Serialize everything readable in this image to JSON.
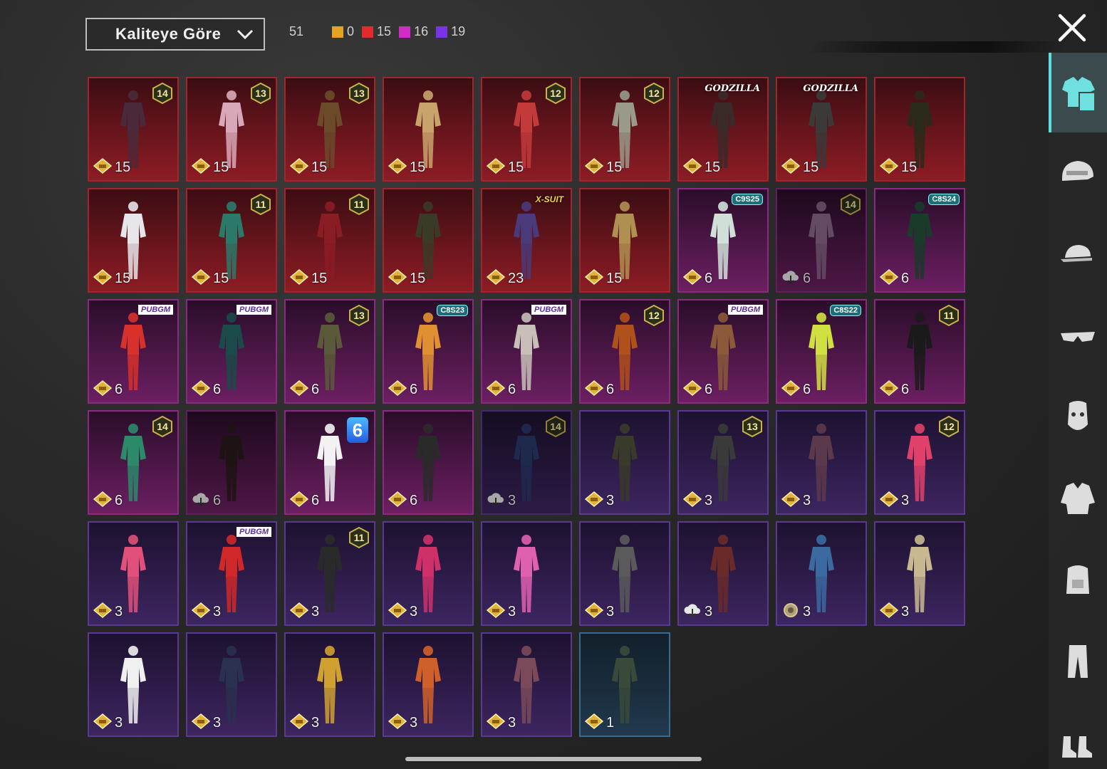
{
  "header": {
    "sort_label": "Kaliteye Göre",
    "total": "51",
    "quality_counts": [
      {
        "color": "#e3a323",
        "count": "0"
      },
      {
        "color": "#e02c2c",
        "count": "15"
      },
      {
        "color": "#d12cc6",
        "count": "16"
      },
      {
        "color": "#7a34e8",
        "count": "19"
      }
    ]
  },
  "items": [
    {
      "tier": "red",
      "badge": "14",
      "count": "15",
      "outfit": "#4a2a3a"
    },
    {
      "tier": "red",
      "badge": "13",
      "count": "15",
      "outfit": "#d9a8b8"
    },
    {
      "tier": "red",
      "badge": "13",
      "count": "15",
      "outfit": "#6b4a2a"
    },
    {
      "tier": "red",
      "badge": "",
      "count": "15",
      "outfit": "#c9a46a"
    },
    {
      "tier": "red",
      "badge": "12",
      "count": "15",
      "outfit": "#c23a3a"
    },
    {
      "tier": "red",
      "badge": "12",
      "count": "15",
      "outfit": "#9a9a8a"
    },
    {
      "tier": "red",
      "label": "GODZILLA",
      "count": "15",
      "outfit": "#3a2a28"
    },
    {
      "tier": "red",
      "label": "GODZILLA",
      "count": "15",
      "outfit": "#3a3a38"
    },
    {
      "tier": "red",
      "badge": "",
      "count": "15",
      "outfit": "#2a2a1a"
    },
    {
      "tier": "red",
      "badge": "",
      "count": "15",
      "outfit": "#e6e6ea"
    },
    {
      "tier": "red",
      "badge": "11",
      "count": "15",
      "outfit": "#2a7a6a"
    },
    {
      "tier": "red",
      "badge": "11",
      "count": "15",
      "outfit": "#8a1c24"
    },
    {
      "tier": "red",
      "badge": "",
      "count": "15",
      "outfit": "#3a3a28"
    },
    {
      "tier": "red",
      "label": "X-SUIT",
      "count": "23",
      "outfit": "#4a3a7a"
    },
    {
      "tier": "red",
      "badge": "",
      "count": "15",
      "outfit": "#b09050"
    },
    {
      "tier": "purple",
      "label": "C9S25",
      "count": "6",
      "outfit": "#d0e0d8"
    },
    {
      "tier": "purple",
      "badge": "14",
      "count": "6",
      "outfit": "#8a6a8a",
      "dim": true,
      "cloud": true
    },
    {
      "tier": "purple",
      "label": "C8S24",
      "count": "6",
      "outfit": "#1a3a2a"
    },
    {
      "tier": "purple",
      "label": "PUBGM",
      "count": "6",
      "outfit": "#d8302a"
    },
    {
      "tier": "purple",
      "label": "PUBGM",
      "count": "6",
      "outfit": "#1a4a4a"
    },
    {
      "tier": "purple",
      "badge": "13",
      "count": "6",
      "outfit": "#5a5a3a"
    },
    {
      "tier": "purple",
      "label": "C8S23",
      "count": "6",
      "outfit": "#e09030"
    },
    {
      "tier": "purple",
      "label": "PUBGM",
      "count": "6",
      "outfit": "#c8c0b8"
    },
    {
      "tier": "purple",
      "badge": "12",
      "count": "6",
      "outfit": "#b0501a"
    },
    {
      "tier": "purple",
      "label": "PUBGM",
      "count": "6",
      "outfit": "#8a5a3a"
    },
    {
      "tier": "purple",
      "label": "C8S22",
      "count": "6",
      "outfit": "#d0e040"
    },
    {
      "tier": "purple",
      "badge": "11",
      "count": "6",
      "outfit": "#1a1a1a"
    },
    {
      "tier": "purple",
      "badge": "14",
      "count": "6",
      "outfit": "#2a8a6a"
    },
    {
      "tier": "purple",
      "badge": "",
      "count": "6",
      "outfit": "#2a1a1a",
      "dim": true,
      "cloud": true
    },
    {
      "tier": "purple",
      "badge": "6",
      "count": "6",
      "outfit": "#f2f2f2"
    },
    {
      "tier": "purple",
      "badge": "",
      "count": "6",
      "outfit": "#2a2a2a"
    },
    {
      "tier": "violet",
      "badge": "14",
      "count": "3",
      "outfit": "#2a3a6a",
      "dim": true,
      "cloud": true
    },
    {
      "tier": "violet",
      "badge": "",
      "count": "3",
      "outfit": "#3a3a2a"
    },
    {
      "tier": "violet",
      "badge": "13",
      "count": "3",
      "outfit": "#3a3a3a"
    },
    {
      "tier": "violet",
      "badge": "",
      "count": "3",
      "outfit": "#5a3a4a"
    },
    {
      "tier": "violet",
      "badge": "12",
      "count": "3",
      "outfit": "#e0406a"
    },
    {
      "tier": "violet",
      "badge": "",
      "count": "3",
      "outfit": "#e0507a"
    },
    {
      "tier": "violet",
      "label": "PUBGM",
      "count": "3",
      "outfit": "#d02828"
    },
    {
      "tier": "violet",
      "badge": "11",
      "count": "3",
      "outfit": "#2a2a2a"
    },
    {
      "tier": "violet",
      "badge": "",
      "count": "3",
      "outfit": "#d0306a"
    },
    {
      "tier": "violet",
      "badge": "",
      "count": "3",
      "outfit": "#e060b0"
    },
    {
      "tier": "violet",
      "badge": "",
      "count": "3",
      "outfit": "#5a5a5a"
    },
    {
      "tier": "violet",
      "badge": "",
      "count": "3",
      "outfit": "#6a2a2a",
      "cloud": true
    },
    {
      "tier": "violet",
      "badge": "",
      "count": "3",
      "outfit": "#3a6aa0",
      "alt": true
    },
    {
      "tier": "violet",
      "badge": "",
      "count": "3",
      "outfit": "#c8b890"
    },
    {
      "tier": "violet",
      "badge": "",
      "count": "3",
      "outfit": "#f0f0f0"
    },
    {
      "tier": "violet",
      "badge": "",
      "count": "3",
      "outfit": "#2a3050"
    },
    {
      "tier": "violet",
      "badge": "",
      "count": "3",
      "outfit": "#d0a030"
    },
    {
      "tier": "violet",
      "badge": "",
      "count": "3",
      "outfit": "#d0602a"
    },
    {
      "tier": "violet",
      "badge": "",
      "count": "3",
      "outfit": "#7a4a5a"
    },
    {
      "tier": "blue",
      "badge": "",
      "count": "1",
      "outfit": "#3a4a3a"
    }
  ],
  "categories": [
    {
      "name": "outfit",
      "active": true
    },
    {
      "name": "helmet",
      "active": false
    },
    {
      "name": "cap",
      "active": false
    },
    {
      "name": "glasses",
      "active": false
    },
    {
      "name": "mask",
      "active": false
    },
    {
      "name": "jacket",
      "active": false
    },
    {
      "name": "backpack",
      "active": false
    },
    {
      "name": "pants",
      "active": false
    },
    {
      "name": "shoes",
      "active": false
    }
  ]
}
